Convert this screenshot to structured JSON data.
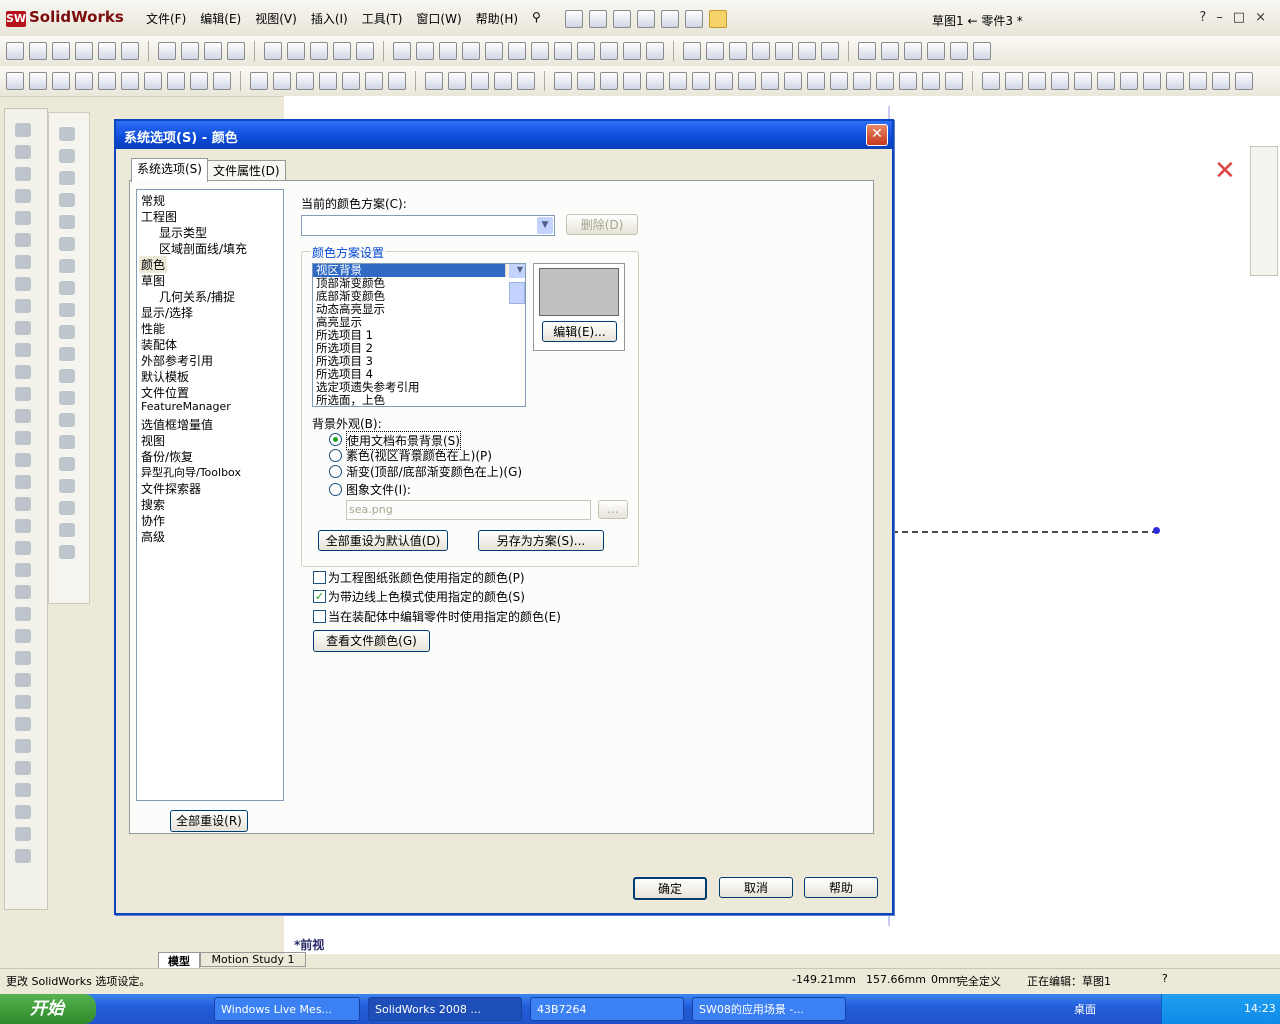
{
  "app": {
    "logo": "SolidWorks",
    "document_title": "草图1 ← 零件3 *"
  },
  "menu": [
    "文件(F)",
    "编辑(E)",
    "视图(V)",
    "插入(I)",
    "工具(T)",
    "窗口(W)",
    "帮助(H)"
  ],
  "window_controls": {
    "help": "?",
    "minimize": "–",
    "restore": "□",
    "close": "×"
  },
  "dialog": {
    "title": "系统选项(S) - 颜色",
    "tabs": [
      "系统选项(S)",
      "文件属性(D)"
    ],
    "tree": [
      "常规",
      "工程图",
      "显示类型",
      "区域剖面线/填充",
      "颜色",
      "草图",
      "几何关系/捕捉",
      "显示/选择",
      "性能",
      "装配体",
      "外部参考引用",
      "默认模板",
      "文件位置",
      "FeatureManager",
      "选值框增量值",
      "视图",
      "备份/恢复",
      "异型孔向导/Toolbox",
      "文件探索器",
      "搜索",
      "协作",
      "高级"
    ],
    "reset_all_button": "全部重设(R)",
    "scheme_label": "当前的颜色方案(C):",
    "scheme_value": "",
    "delete_button": "删除(D)",
    "group_title": "颜色方案设置",
    "color_items": [
      "视区背景",
      "顶部渐变颜色",
      "底部渐变颜色",
      "动态高亮显示",
      "高亮显示",
      "所选项目 1",
      "所选项目 2",
      "所选项目 3",
      "所选项目 4",
      "选定项遗失参考引用",
      "所选面，上色"
    ],
    "swatch_color": "#c0c0c0",
    "edit_button": "编辑(E)...",
    "bg_label": "背景外观(B):",
    "radios": [
      "使用文档布景背景(S)",
      "素色(视区背景颜色在上)(P)",
      "渐变(顶部/底部渐变颜色在上)(G)",
      "图象文件(I):"
    ],
    "image_file": "sea.png",
    "browse_button": "...",
    "reset_default_button": "全部重设为默认值(D)",
    "save_scheme_button": "另存为方案(S)...",
    "checkboxes": [
      "为工程图纸张颜色使用指定的颜色(P)",
      "为带边线上色模式使用指定的颜色(S)",
      "当在装配体中编辑零件时使用指定的颜色(E)"
    ],
    "view_doc_colors_button": "查看文件颜色(G)",
    "ok": "确定",
    "cancel": "取消",
    "help": "帮助"
  },
  "view_label": "*前视",
  "bottom_tabs": [
    "模型",
    "Motion Study 1"
  ],
  "status": {
    "message": "更改 SolidWorks 选项设定。",
    "x": "-149.21mm",
    "y": "157.66mm",
    "z": "0mm",
    "state": "完全定义",
    "editing": "正在编辑：草图1"
  },
  "taskbar": {
    "start": "开始",
    "tasks": [
      "Windows Live Mes...",
      "SolidWorks 2008 ...",
      "43B7264",
      "SW08的应用场景 -..."
    ],
    "desktop": "桌面",
    "time": "14:23"
  }
}
